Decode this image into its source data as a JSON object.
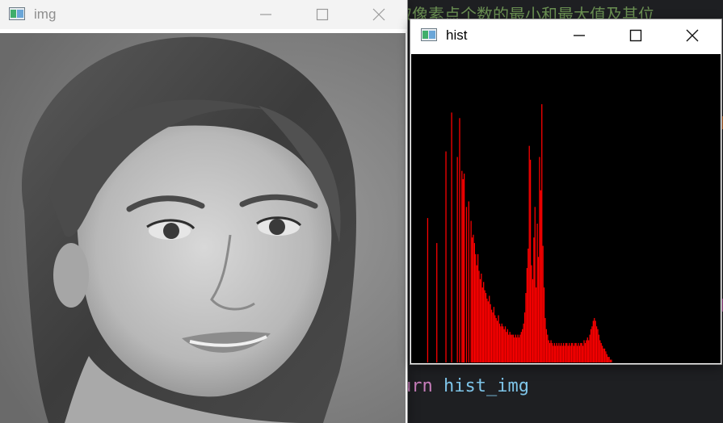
{
  "editor": {
    "comment_line": "获取像素点个数的最小和最大值及其位",
    "return_keyword": "urn",
    "return_value": "hist_img",
    "colors": {
      "background": "#1e1f22",
      "comment": "#6a8f52",
      "keyword": "#c77dbb",
      "identifier": "#7ec4e8"
    }
  },
  "img_window": {
    "title": "img",
    "icon": "opencv-window-icon",
    "image": "grayscale-portrait-photo",
    "controls": [
      "minimize-icon",
      "maximize-icon",
      "close-icon"
    ]
  },
  "hist_window": {
    "title": "hist",
    "icon": "opencv-window-icon",
    "controls": [
      "minimize-icon",
      "maximize-icon",
      "close-icon"
    ],
    "background_color": "#000000",
    "bar_color": "#ff0000"
  },
  "chart_data": {
    "type": "bar",
    "bins": 256,
    "xlim": [
      0,
      255
    ],
    "ylim": [
      0,
      1
    ],
    "value_unit": "fraction of max bin count",
    "values": [
      0,
      0,
      0,
      0,
      0,
      0,
      0,
      0,
      0,
      0,
      0,
      0,
      0,
      0,
      0.52,
      0,
      0,
      0,
      0,
      0,
      0,
      0,
      0.43,
      0,
      0,
      0,
      0,
      0,
      0,
      0,
      0.76,
      0,
      0,
      0,
      0,
      0.9,
      0,
      0,
      0,
      0,
      0.74,
      0,
      0.88,
      0,
      0.69,
      0.66,
      0.68,
      0,
      0.56,
      0,
      0.58,
      0,
      0.51,
      0.45,
      0.46,
      0.43,
      0.39,
      0.35,
      0.39,
      0.33,
      0.3,
      0.32,
      0.27,
      0.29,
      0.26,
      0.25,
      0.23,
      0.22,
      0.24,
      0.21,
      0.19,
      0.18,
      0.2,
      0.17,
      0.16,
      0.15,
      0.17,
      0.14,
      0.13,
      0.14,
      0.13,
      0.12,
      0.13,
      0.11,
      0.12,
      0.1,
      0.11,
      0.1,
      0.1,
      0.1,
      0.09,
      0.1,
      0.09,
      0.1,
      0.09,
      0.1,
      0.11,
      0.12,
      0.14,
      0.18,
      0.25,
      0.34,
      0.41,
      0.78,
      0.73,
      0.35,
      0.3,
      0.45,
      0.56,
      0.27,
      0.5,
      0.38,
      0.74,
      0.62,
      0.93,
      0.42,
      0.27,
      0.16,
      0.12,
      0.1,
      0.08,
      0.07,
      0.08,
      0.07,
      0.06,
      0.07,
      0.06,
      0.07,
      0.06,
      0.07,
      0.06,
      0.07,
      0.06,
      0.07,
      0.06,
      0.07,
      0.07,
      0.06,
      0.07,
      0.06,
      0.07,
      0.07,
      0.06,
      0.07,
      0.07,
      0.06,
      0.07,
      0.06,
      0.07,
      0.07,
      0.06,
      0.08,
      0.07,
      0.08,
      0.09,
      0.08,
      0.1,
      0.12,
      0.13,
      0.15,
      0.16,
      0.15,
      0.13,
      0.12,
      0.1,
      0.08,
      0.07,
      0.06,
      0.05,
      0.05,
      0.04,
      0.03,
      0.02,
      0.02,
      0.01,
      0.01,
      0,
      0,
      0,
      0,
      0,
      0,
      0,
      0,
      0,
      0,
      0,
      0,
      0,
      0,
      0,
      0,
      0,
      0,
      0,
      0,
      0,
      0,
      0,
      0,
      0,
      0,
      0,
      0,
      0,
      0,
      0,
      0,
      0,
      0,
      0,
      0,
      0,
      0,
      0,
      0,
      0,
      0,
      0,
      0,
      0,
      0,
      0,
      0,
      0,
      0,
      0,
      0,
      0,
      0,
      0,
      0,
      0,
      0,
      0,
      0,
      0,
      0,
      0,
      0,
      0,
      0,
      0,
      0,
      0,
      0,
      0,
      0,
      0,
      0,
      0,
      0,
      0,
      0,
      0,
      0,
      0,
      0,
      0,
      0,
      0,
      0,
      0,
      0,
      0,
      0,
      0,
      0,
      0,
      0,
      0
    ]
  }
}
